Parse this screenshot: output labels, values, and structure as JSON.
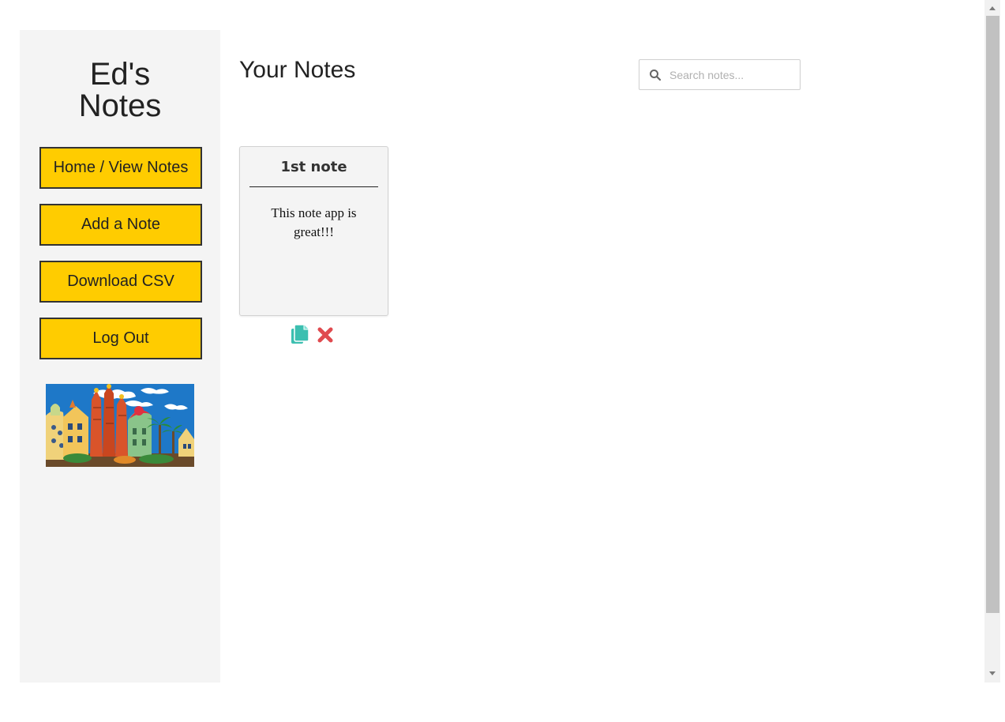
{
  "sidebar": {
    "title_line1": "Ed's",
    "title_line2": "Notes",
    "buttons": [
      {
        "label": "Home / View Notes"
      },
      {
        "label": "Add a Note"
      },
      {
        "label": "Download CSV"
      },
      {
        "label": "Log Out"
      }
    ],
    "image_icon": "barcelona-gaudi-illustration"
  },
  "main": {
    "title": "Your Notes",
    "search": {
      "placeholder": "Search notes...",
      "value": "",
      "icon": "search-icon"
    },
    "notes": [
      {
        "title": "1st note",
        "body": "This note app is great!!!",
        "actions": [
          "copy-icon",
          "delete-icon"
        ]
      }
    ]
  },
  "colors": {
    "button_bg": "#ffcc00",
    "sidebar_bg": "#f4f4f4",
    "copy_icon": "#3cbfb0",
    "delete_icon": "#e04a4f"
  }
}
